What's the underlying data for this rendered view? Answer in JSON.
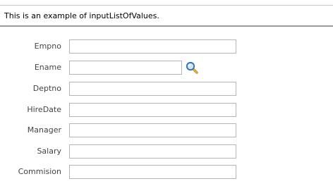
{
  "header": {
    "text": "This is an example of inputListOfValues."
  },
  "form": {
    "fields": [
      {
        "label": "Empno",
        "value": ""
      },
      {
        "label": "Ename",
        "value": ""
      },
      {
        "label": "Deptno",
        "value": ""
      },
      {
        "label": "HireDate",
        "value": ""
      },
      {
        "label": "Manager",
        "value": ""
      },
      {
        "label": "Salary",
        "value": ""
      },
      {
        "label": "Commision",
        "value": ""
      }
    ],
    "lov_icon": "search-icon"
  }
}
